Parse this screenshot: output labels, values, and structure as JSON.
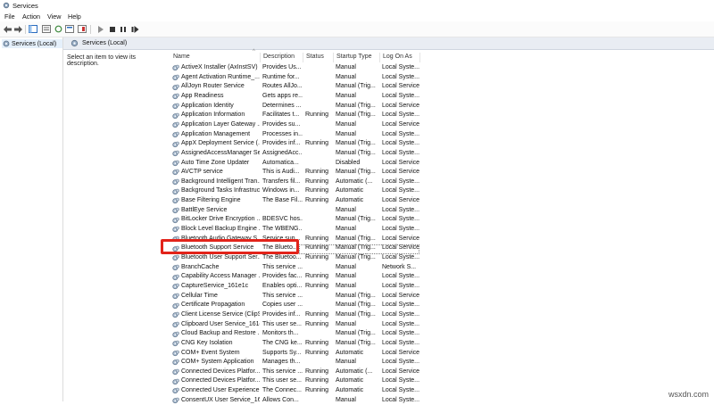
{
  "window": {
    "title": "Services"
  },
  "menu": [
    "File",
    "Action",
    "View",
    "Help"
  ],
  "tree": {
    "root_label": "Services (Local)"
  },
  "panel": {
    "header_label": "Services (Local)",
    "description_prompt": "Select an item to view its description."
  },
  "columns": {
    "name": "Name",
    "description": "Description",
    "status": "Status",
    "startup": "Startup Type",
    "logon": "Log On As"
  },
  "services": [
    {
      "name": "ActiveX Installer (AxInstSV)",
      "description": "Provides Us...",
      "status": "",
      "startup": "Manual",
      "logon": "Local Syste..."
    },
    {
      "name": "Agent Activation Runtime_...",
      "description": "Runtime for...",
      "status": "",
      "startup": "Manual",
      "logon": "Local Syste..."
    },
    {
      "name": "AllJoyn Router Service",
      "description": "Routes AllJo...",
      "status": "",
      "startup": "Manual (Trig...",
      "logon": "Local Service"
    },
    {
      "name": "App Readiness",
      "description": "Gets apps re...",
      "status": "",
      "startup": "Manual",
      "logon": "Local Syste..."
    },
    {
      "name": "Application Identity",
      "description": "Determines ...",
      "status": "",
      "startup": "Manual (Trig...",
      "logon": "Local Service"
    },
    {
      "name": "Application Information",
      "description": "Facilitates t...",
      "status": "Running",
      "startup": "Manual (Trig...",
      "logon": "Local Syste..."
    },
    {
      "name": "Application Layer Gateway ...",
      "description": "Provides su...",
      "status": "",
      "startup": "Manual",
      "logon": "Local Service"
    },
    {
      "name": "Application Management",
      "description": "Processes in...",
      "status": "",
      "startup": "Manual",
      "logon": "Local Syste..."
    },
    {
      "name": "AppX Deployment Service (...",
      "description": "Provides inf...",
      "status": "Running",
      "startup": "Manual (Trig...",
      "logon": "Local Syste..."
    },
    {
      "name": "AssignedAccessManager Se...",
      "description": "AssignedAcc...",
      "status": "",
      "startup": "Manual (Trig...",
      "logon": "Local Syste..."
    },
    {
      "name": "Auto Time Zone Updater",
      "description": "Automatica...",
      "status": "",
      "startup": "Disabled",
      "logon": "Local Service"
    },
    {
      "name": "AVCTP service",
      "description": "This is Audi...",
      "status": "Running",
      "startup": "Manual (Trig...",
      "logon": "Local Service"
    },
    {
      "name": "Background Intelligent Tran...",
      "description": "Transfers fil...",
      "status": "Running",
      "startup": "Automatic (...",
      "logon": "Local Syste..."
    },
    {
      "name": "Background Tasks Infrastruc...",
      "description": "Windows in...",
      "status": "Running",
      "startup": "Automatic",
      "logon": "Local Syste..."
    },
    {
      "name": "Base Filtering Engine",
      "description": "The Base Fil...",
      "status": "Running",
      "startup": "Automatic",
      "logon": "Local Service"
    },
    {
      "name": "BattlEye Service",
      "description": "",
      "status": "",
      "startup": "Manual",
      "logon": "Local Syste..."
    },
    {
      "name": "BitLocker Drive Encryption ...",
      "description": "BDESVC hos...",
      "status": "",
      "startup": "Manual (Trig...",
      "logon": "Local Syste..."
    },
    {
      "name": "Block Level Backup Engine ...",
      "description": "The WBENG...",
      "status": "",
      "startup": "Manual",
      "logon": "Local Syste..."
    },
    {
      "name": "Bluetooth Audio Gateway S...",
      "description": "Service sup...",
      "status": "Running",
      "startup": "Manual (Trig...",
      "logon": "Local Service"
    },
    {
      "name": "Bluetooth Support Service",
      "description": "The Blueto...",
      "status": "Running",
      "startup": "Manual (Trig...",
      "logon": "Local Service"
    },
    {
      "name": "Bluetooth User Support Ser...",
      "description": "The Bluetoo...",
      "status": "Running",
      "startup": "Manual (Trig...",
      "logon": "Local Syste..."
    },
    {
      "name": "BranchCache",
      "description": "This service ...",
      "status": "",
      "startup": "Manual",
      "logon": "Network S..."
    },
    {
      "name": "Capability Access Manager ...",
      "description": "Provides fac...",
      "status": "Running",
      "startup": "Manual",
      "logon": "Local Syste..."
    },
    {
      "name": "CaptureService_161e1c",
      "description": "Enables opti...",
      "status": "Running",
      "startup": "Manual",
      "logon": "Local Syste..."
    },
    {
      "name": "Cellular Time",
      "description": "This service ...",
      "status": "",
      "startup": "Manual (Trig...",
      "logon": "Local Service"
    },
    {
      "name": "Certificate Propagation",
      "description": "Copies user ...",
      "status": "",
      "startup": "Manual (Trig...",
      "logon": "Local Syste..."
    },
    {
      "name": "Client License Service (ClipS...",
      "description": "Provides inf...",
      "status": "Running",
      "startup": "Manual (Trig...",
      "logon": "Local Syste..."
    },
    {
      "name": "Clipboard User Service_161e...",
      "description": "This user se...",
      "status": "Running",
      "startup": "Manual",
      "logon": "Local Syste..."
    },
    {
      "name": "Cloud Backup and Restore ...",
      "description": "Monitors th...",
      "status": "",
      "startup": "Manual (Trig...",
      "logon": "Local Syste..."
    },
    {
      "name": "CNG Key Isolation",
      "description": "The CNG ke...",
      "status": "Running",
      "startup": "Manual (Trig...",
      "logon": "Local Syste..."
    },
    {
      "name": "COM+ Event System",
      "description": "Supports Sy...",
      "status": "Running",
      "startup": "Automatic",
      "logon": "Local Service"
    },
    {
      "name": "COM+ System Application",
      "description": "Manages th...",
      "status": "",
      "startup": "Manual",
      "logon": "Local Syste..."
    },
    {
      "name": "Connected Devices Platfor...",
      "description": "This service ...",
      "status": "Running",
      "startup": "Automatic (...",
      "logon": "Local Service"
    },
    {
      "name": "Connected Devices Platfor...",
      "description": "This user se...",
      "status": "Running",
      "startup": "Automatic",
      "logon": "Local Syste..."
    },
    {
      "name": "Connected User Experience...",
      "description": "The Connec...",
      "status": "Running",
      "startup": "Automatic",
      "logon": "Local Syste..."
    },
    {
      "name": "ConsentUX User Service_16...",
      "description": "Allows Con...",
      "status": "",
      "startup": "Manual",
      "logon": "Local Syste..."
    }
  ],
  "selected_service": "Bluetooth Support Service",
  "watermark": "wsxdn.com"
}
